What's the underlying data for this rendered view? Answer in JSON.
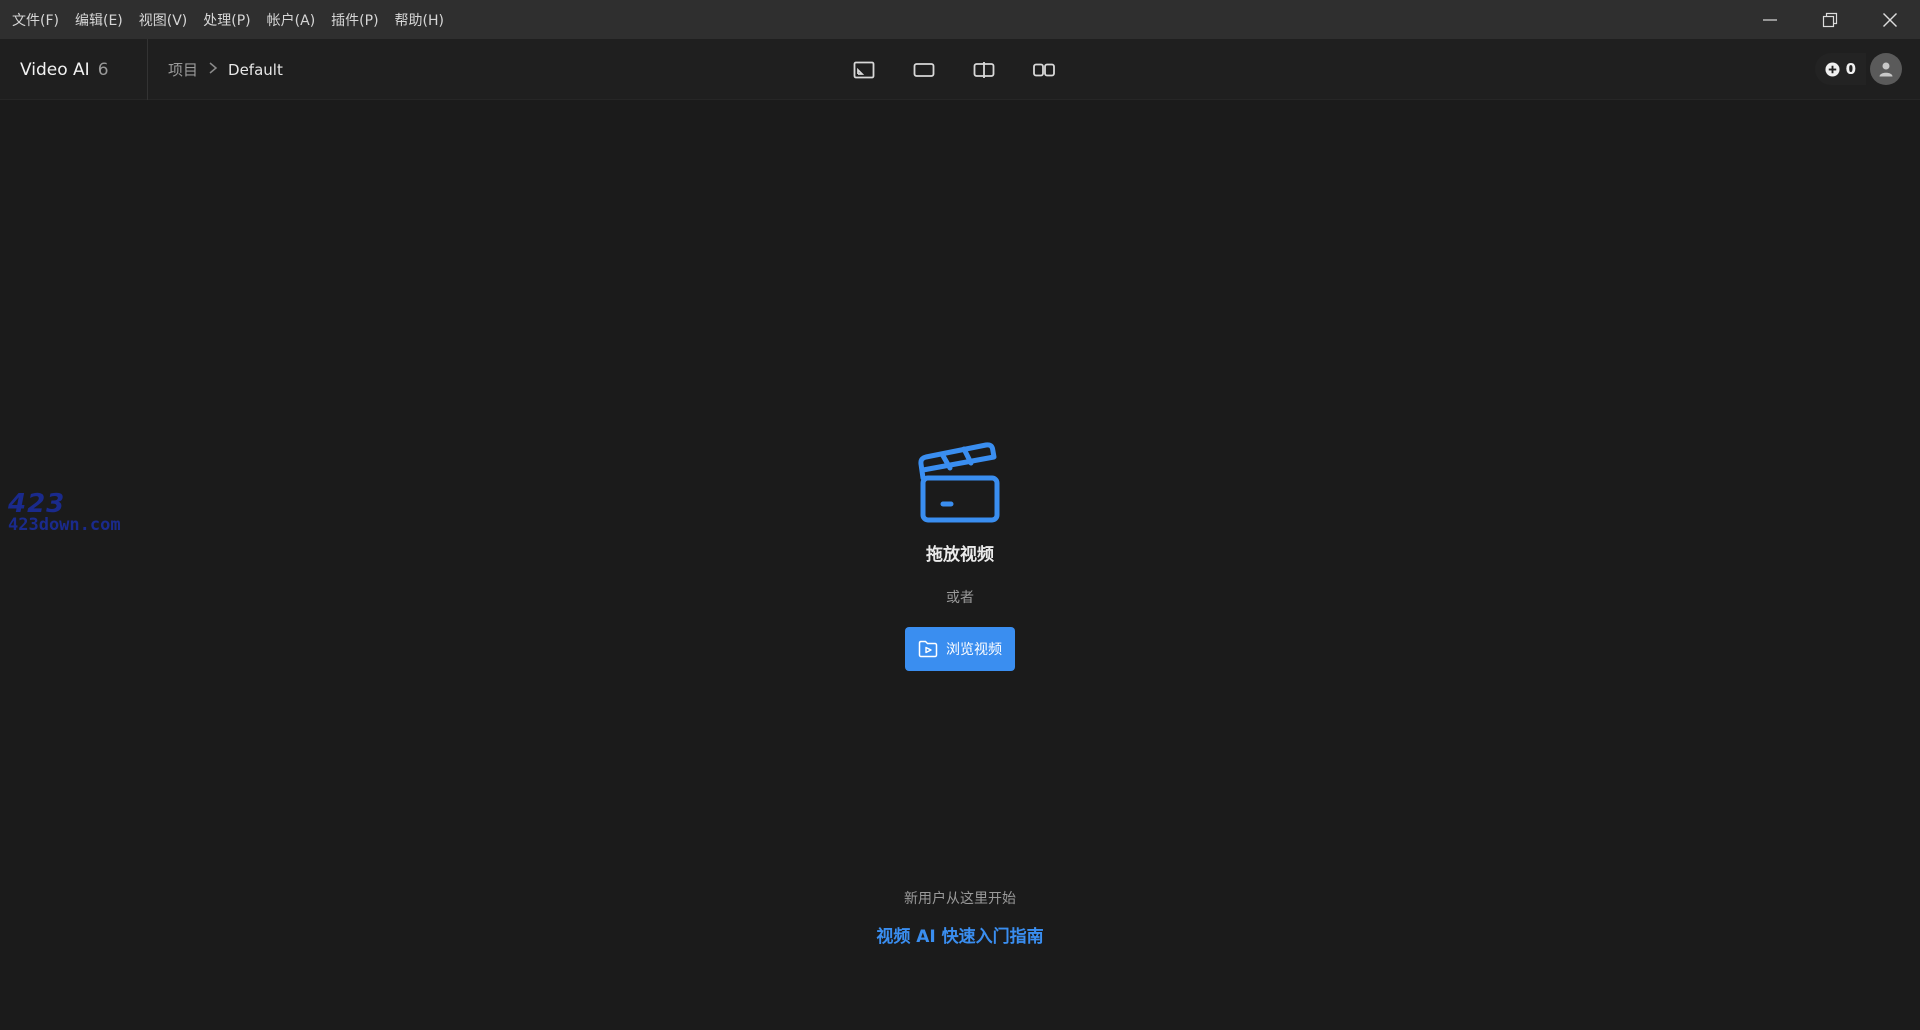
{
  "menu": {
    "items": [
      "文件(F)",
      "编辑(E)",
      "视图(V)",
      "处理(P)",
      "帐户(A)",
      "插件(P)",
      "帮助(H)"
    ]
  },
  "window_controls": {
    "minimize": "minimize-icon",
    "restore": "restore-icon",
    "close": "close-icon"
  },
  "app": {
    "name": "Video AI",
    "version": "6"
  },
  "breadcrumb": {
    "root": "项目",
    "separator": ">",
    "current": "Default"
  },
  "view_modes": [
    "single-view-icon",
    "full-view-icon",
    "split-view-icon",
    "side-by-side-icon"
  ],
  "account": {
    "credits": "0"
  },
  "drop_area": {
    "title": "拖放视频",
    "or": "或者",
    "browse_label": "浏览视频"
  },
  "footer": {
    "hint": "新用户从这里开始",
    "link": "视频 AI 快速入门指南"
  },
  "watermark": {
    "top": "423",
    "bottom": "423down.com"
  },
  "colors": {
    "accent": "#3a8ef0",
    "background": "#1b1b1b",
    "menubar": "#2f2f2f"
  }
}
